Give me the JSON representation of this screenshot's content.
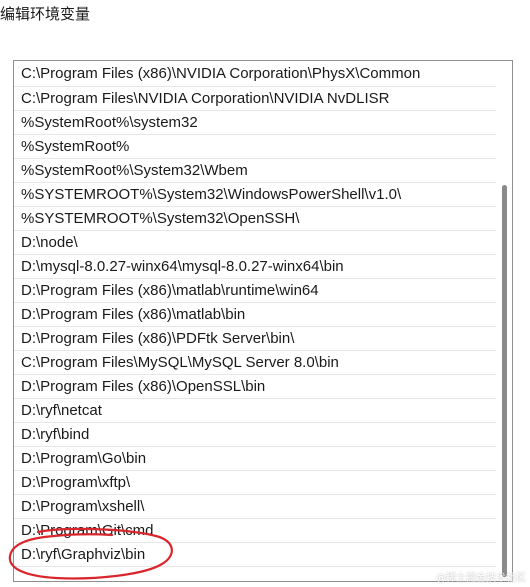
{
  "dialog": {
    "title": "编辑环境变量"
  },
  "path_list": {
    "items": [
      "C:\\Program Files (x86)\\NVIDIA Corporation\\PhysX\\Common",
      "C:\\Program Files\\NVIDIA Corporation\\NVIDIA NvDLISR",
      "%SystemRoot%\\system32",
      "%SystemRoot%",
      "%SystemRoot%\\System32\\Wbem",
      "%SYSTEMROOT%\\System32\\WindowsPowerShell\\v1.0\\",
      "%SYSTEMROOT%\\System32\\OpenSSH\\",
      "D:\\node\\",
      "D:\\mysql-8.0.27-winx64\\mysql-8.0.27-winx64\\bin",
      "D:\\Program Files (x86)\\matlab\\runtime\\win64",
      "D:\\Program Files (x86)\\matlab\\bin",
      "D:\\Program Files (x86)\\PDFtk Server\\bin\\",
      "C:\\Program Files\\MySQL\\MySQL Server 8.0\\bin",
      "D:\\Program Files (x86)\\OpenSSL\\bin",
      "D:\\ryf\\netcat",
      "D:\\ryf\\bind",
      "D:\\Program\\Go\\bin",
      "D:\\Program\\xftp\\",
      "D:\\Program\\xshell\\",
      "D:\\Program\\Git\\cmd",
      "D:\\ryf\\Graphviz\\bin"
    ],
    "highlighted_item": "D:\\ryf\\Graphviz\\bin"
  },
  "annotation": {
    "color": "#d9262c",
    "shape": "hand-drawn-circle"
  },
  "watermark": {
    "text": "@稀土掘金技术社区"
  }
}
